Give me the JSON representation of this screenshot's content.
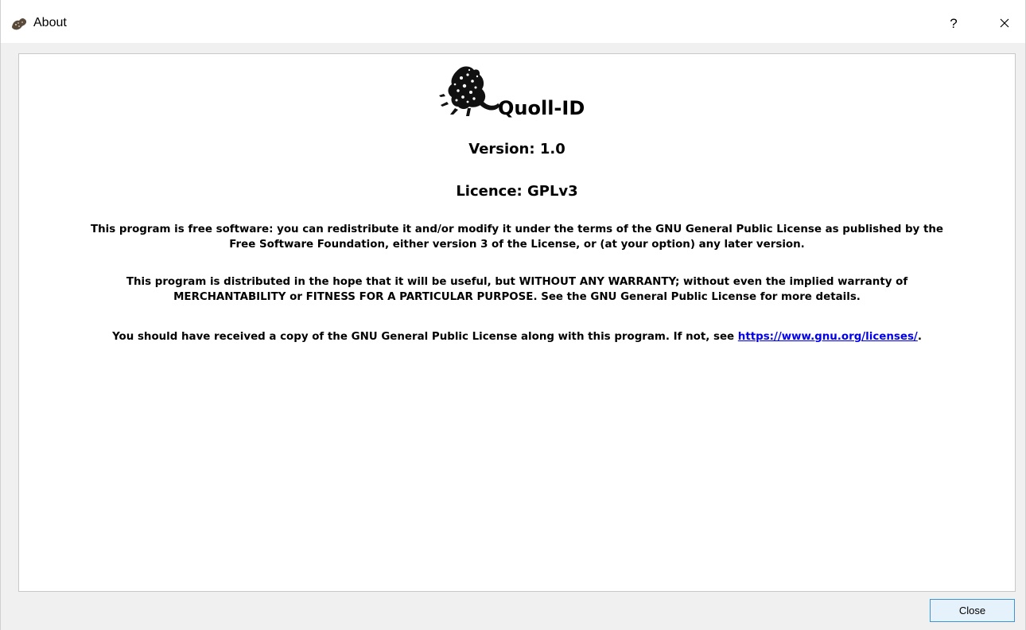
{
  "window": {
    "title": "About",
    "help_label": "?",
    "close_icon": "close-icon"
  },
  "about": {
    "app_name": "Quoll-ID",
    "version": "Version: 1.0",
    "licence": "Licence: GPLv3",
    "para1_line1": "This program is free software: you can redistribute it and/or modify it under the terms of the GNU General Public License as published by the",
    "para1_line2": "Free Software Foundation, either version 3 of the License, or (at your option) any later version.",
    "para2_line1": "This program is distributed in the hope that it will be useful, but WITHOUT ANY WARRANTY; without even the implied warranty of",
    "para2_line2": "MERCHANTABILITY or FITNESS FOR A PARTICULAR PURPOSE. See the GNU General Public License for more details.",
    "para3_prefix": "You should have received a copy of the GNU General Public License along with this program. If not, see ",
    "para3_link": "https://www.gnu.org/licenses/",
    "para3_suffix": "."
  },
  "footer": {
    "close_label": "Close"
  },
  "colors": {
    "link": "#0000ee",
    "button_bg": "#e5f1fb",
    "button_border": "#3c95d6"
  }
}
